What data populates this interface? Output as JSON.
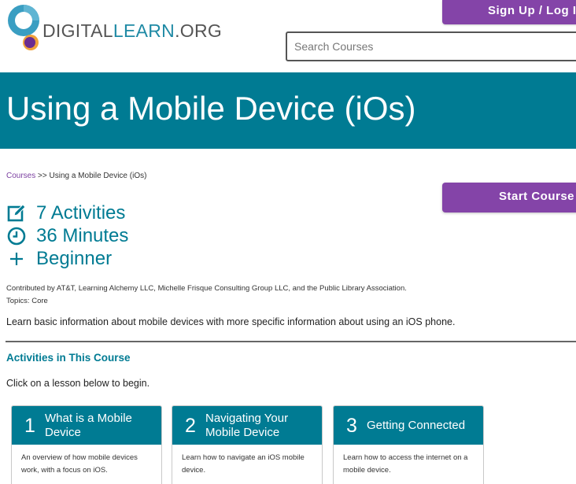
{
  "header": {
    "logo": {
      "part1": "DIGITAL",
      "part2": "LEARN",
      "part3": ".ORG"
    },
    "signup_label": "Sign Up / Log In",
    "search": {
      "placeholder": "Search Courses",
      "value": ""
    }
  },
  "banner": {
    "title": "Using a Mobile Device (iOs)"
  },
  "breadcrumb": {
    "link": "Courses",
    "separator": " >> ",
    "current": "Using a Mobile Device (iOs)"
  },
  "start_button": "Start Course",
  "stats": [
    {
      "icon": "edit-icon",
      "label": "7 Activities"
    },
    {
      "icon": "clock-icon",
      "label": "36 Minutes"
    },
    {
      "icon": "plus-icon",
      "label": "Beginner"
    }
  ],
  "contributors": "Contributed by AT&T, Learning Alchemy LLC, Michelle Frisque Consulting Group LLC, and the Public Library Association.",
  "topics": "Topics: Core",
  "description": "Learn basic information about mobile devices with more specific information about using an iOS phone.",
  "activities": {
    "title": "Activities in This Course",
    "instruction": "Click on a lesson below to begin.",
    "cards": [
      {
        "number": "1",
        "title": "What is a Mobile Device",
        "text": "An overview of how mobile devices work, with a focus on iOS."
      },
      {
        "number": "2",
        "title": "Navigating Your Mobile Device",
        "text": "Learn how to navigate an iOS mobile device."
      },
      {
        "number": "3",
        "title": "Getting Connected",
        "text": "Learn how to access the internet on a mobile device."
      }
    ]
  },
  "colors": {
    "teal": "#007b93",
    "purple": "#8444a8",
    "logo_blue": "#1f8aa5",
    "logo_purple": "#6a2c91",
    "logo_orange": "#f0a23a"
  }
}
